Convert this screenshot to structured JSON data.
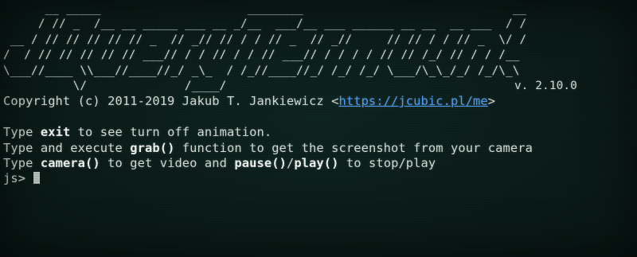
{
  "banner": {
    "lines": [
      "      __ _____                     ________                              __",
      "     / // _  /__ __ _____ ___ __ _/__  ___/__ ___ ______ __ __  __ ___  / /",
      " __ / // // // // // _  // _// // / / // _  // _//     // // / / // _  \\/ /",
      "/  / // // // // // ___// / / // / / // ___// / / / / // // /_/ // / / /__",
      "\\___//____ \\\\___//____//_/ _\\_  / /_//____//_/ /_/ /_/ \\___/\\_\\_/_/ /_/\\_\\",
      "          \\/              /____/                                        "
    ],
    "version": "v. 2.10.0"
  },
  "copyright": {
    "text_before": "Copyright (c) 2011-2019 Jakub T. Jankiewicz <",
    "link_text": "https://jcubic.pl/me",
    "text_after": ">"
  },
  "instructions": {
    "line1": {
      "pre": "Type ",
      "cmd": "exit",
      "post": " to see turn off animation."
    },
    "line2": {
      "pre": "Type and execute ",
      "cmd": "grab()",
      "post": " function to get the screenshot from your camera"
    },
    "line3": {
      "pre": "Type ",
      "cmd1": "camera()",
      "mid1": " to get video and ",
      "cmd2": "pause()",
      "mid2": "/",
      "cmd3": "play()",
      "post": " to stop/play"
    }
  },
  "prompt": {
    "text": "js> "
  },
  "colors": {
    "background": "#0b1c19",
    "text": "#d6dcd8",
    "link": "#4da0ff",
    "bold": "#f1f4f2"
  }
}
